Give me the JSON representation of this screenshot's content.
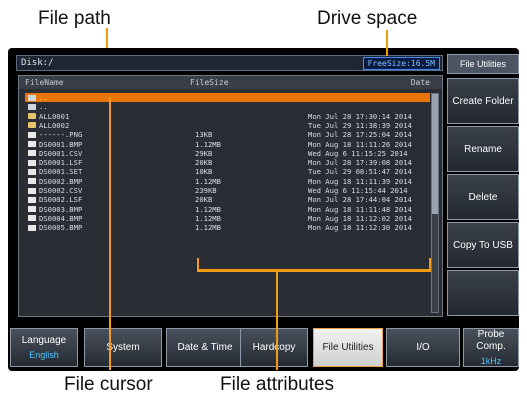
{
  "callouts": {
    "file_path": "File path",
    "drive_space": "Drive space",
    "file_cursor": "File cursor",
    "file_attributes": "File attributes"
  },
  "screen": {
    "disk_path": "Disk:/",
    "free_size": "FreeSize:16.5M",
    "columns": {
      "name": "FileName",
      "size": "FileSize",
      "date": "Date"
    },
    "files": [
      {
        "name": "..",
        "size": "",
        "date": "",
        "icon": "up-folder-icon",
        "selected": true
      },
      {
        "name": "..",
        "size": "",
        "date": "",
        "icon": "up-folder-icon",
        "selected": false
      },
      {
        "name": "ALL0001",
        "size": "",
        "date": "Mon Jul 28 17:30:14 2014",
        "icon": "folder-icon",
        "selected": false
      },
      {
        "name": "ALL0002",
        "size": "",
        "date": "Tue Jul 29 11:38:39 2014",
        "icon": "folder-icon",
        "selected": false
      },
      {
        "name": "------.PNG",
        "size": "13KB",
        "date": "Mon Jul 28 17:25:04 2014",
        "icon": "file-icon",
        "selected": false
      },
      {
        "name": "DS0001.BMP",
        "size": "1.12MB",
        "date": "Mon Aug 18 11:11:26 2014",
        "icon": "file-icon",
        "selected": false
      },
      {
        "name": "DS0001.CSV",
        "size": "29KB",
        "date": "Wed Aug  6 11:15:25 2014",
        "icon": "file-icon",
        "selected": false
      },
      {
        "name": "DS0001.LSF",
        "size": "20KB",
        "date": "Mon Jul 28 17:39:08 2014",
        "icon": "file-icon",
        "selected": false
      },
      {
        "name": "DS0001.SET",
        "size": "10KB",
        "date": "Tue Jul 29 08:51:47 2014",
        "icon": "file-icon",
        "selected": false
      },
      {
        "name": "DS0002.BMP",
        "size": "1.12MB",
        "date": "Mon Aug 18 11:11:39 2014",
        "icon": "file-icon",
        "selected": false
      },
      {
        "name": "DS0002.CSV",
        "size": "239KB",
        "date": "Wed Aug  6 11:15:44 2014",
        "icon": "file-icon",
        "selected": false
      },
      {
        "name": "DS0002.LSF",
        "size": "20KB",
        "date": "Mon Jul 28 17:44:04 2014",
        "icon": "file-icon",
        "selected": false
      },
      {
        "name": "DS0003.BMP",
        "size": "1.12MB",
        "date": "Mon Aug 18 11:11:48 2014",
        "icon": "file-icon",
        "selected": false
      },
      {
        "name": "DS0004.BMP",
        "size": "1.12MB",
        "date": "Mon Aug 18 11:12:02 2014",
        "icon": "file-icon",
        "selected": false
      },
      {
        "name": "DS0005.BMP",
        "size": "1.12MB",
        "date": "Mon Aug 18 11:12:30 2014",
        "icon": "file-icon",
        "selected": false
      }
    ]
  },
  "side_menu": {
    "title": "File Utilities",
    "create_folder": "Create Folder",
    "rename": "Rename",
    "delete": "Delete",
    "copy_to_usb": "Copy To USB"
  },
  "bottom_menu": {
    "language": "Language",
    "language_value": "English",
    "system": "System",
    "date_time": "Date & Time",
    "hardcopy": "Hardcopy",
    "file_utilities": "File Utilities",
    "io": "I/O",
    "probe_comp": "Probe Comp.",
    "probe_comp_value": "1kHz"
  },
  "colors": {
    "accent": "#f39c12",
    "selection": "#e8740a",
    "free_size_border": "#3c8cff",
    "sub_label": "#4cc6ff"
  }
}
